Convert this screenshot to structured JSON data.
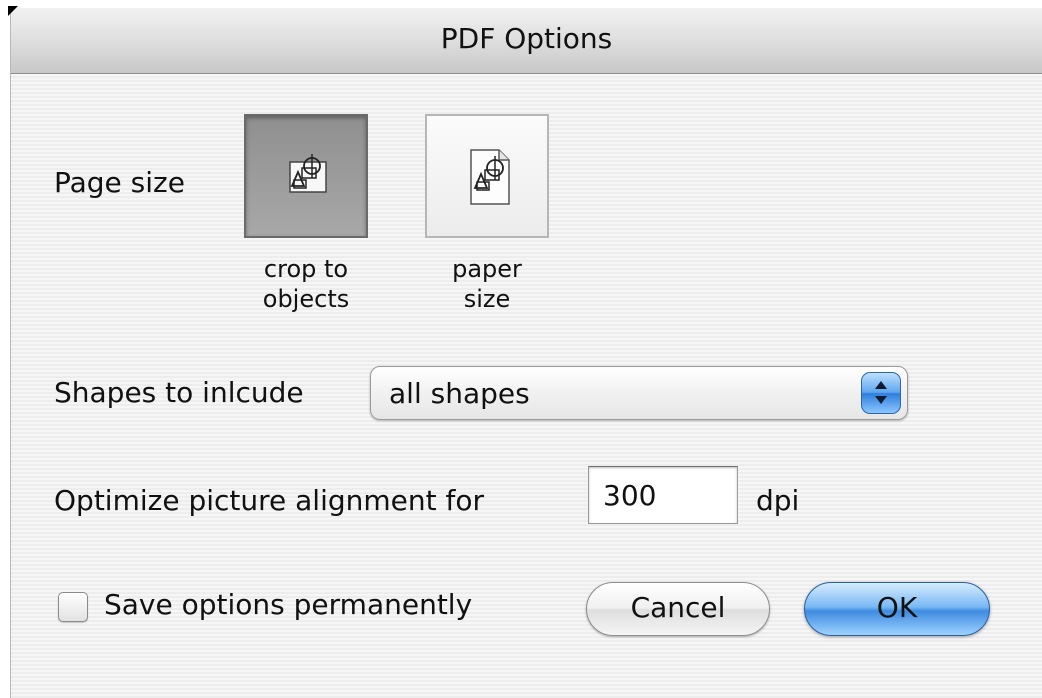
{
  "dialog": {
    "title": "PDF Options"
  },
  "page_size": {
    "label": "Page size",
    "options": [
      {
        "caption_line1": "crop to",
        "caption_line2": "objects",
        "icon": "crop-to-objects-icon",
        "selected": true
      },
      {
        "caption_line1": "paper",
        "caption_line2": "size",
        "icon": "paper-size-icon",
        "selected": false
      }
    ]
  },
  "shapes": {
    "label": "Shapes to inlcude",
    "selected_value": "all shapes"
  },
  "optimize": {
    "label": "Optimize picture alignment for",
    "value": "300",
    "unit": "dpi"
  },
  "save_options": {
    "label": "Save options permanently",
    "checked": false
  },
  "buttons": {
    "cancel": "Cancel",
    "ok": "OK"
  },
  "colors": {
    "ok_button": "#3e8be0",
    "selected_option": "#9a9a9a"
  }
}
